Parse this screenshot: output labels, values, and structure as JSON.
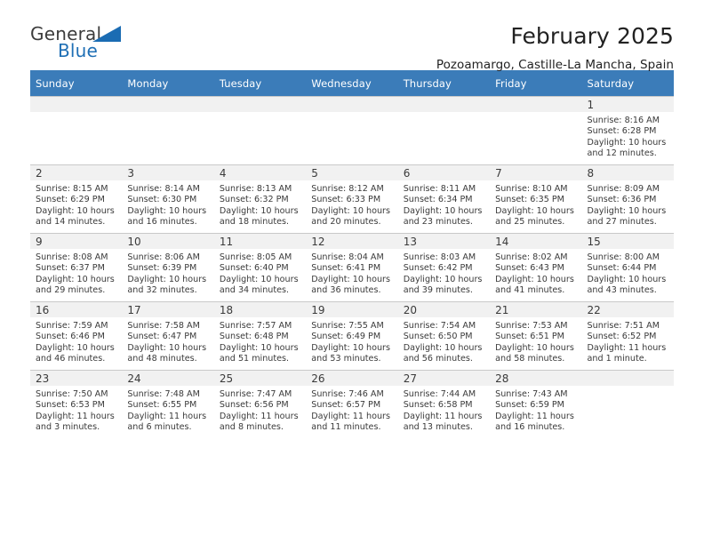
{
  "brand": {
    "word1": "General",
    "word2": "Blue",
    "triangle_color": "#1b6cb3",
    "text_color": "#3c3c3c"
  },
  "header": {
    "title": "February 2025",
    "subtitle": "Pozoamargo, Castille-La Mancha, Spain"
  },
  "theme": {
    "header_blue": "#3b7cb9",
    "daynum_band": "#f1f1f1",
    "grid_line": "#c9c9c9"
  },
  "weekday_headers": [
    "Sunday",
    "Monday",
    "Tuesday",
    "Wednesday",
    "Thursday",
    "Friday",
    "Saturday"
  ],
  "labels": {
    "sunrise_prefix": "Sunrise: ",
    "sunset_prefix": "Sunset: ",
    "daylight_prefix": "Daylight: "
  },
  "weeks": [
    [
      {
        "day": "",
        "sunrise": "",
        "sunset": "",
        "daylight": ""
      },
      {
        "day": "",
        "sunrise": "",
        "sunset": "",
        "daylight": ""
      },
      {
        "day": "",
        "sunrise": "",
        "sunset": "",
        "daylight": ""
      },
      {
        "day": "",
        "sunrise": "",
        "sunset": "",
        "daylight": ""
      },
      {
        "day": "",
        "sunrise": "",
        "sunset": "",
        "daylight": ""
      },
      {
        "day": "",
        "sunrise": "",
        "sunset": "",
        "daylight": ""
      },
      {
        "day": "1",
        "sunrise": "Sunrise: 8:16 AM",
        "sunset": "Sunset: 6:28 PM",
        "daylight": "Daylight: 10 hours and 12 minutes."
      }
    ],
    [
      {
        "day": "2",
        "sunrise": "Sunrise: 8:15 AM",
        "sunset": "Sunset: 6:29 PM",
        "daylight": "Daylight: 10 hours and 14 minutes."
      },
      {
        "day": "3",
        "sunrise": "Sunrise: 8:14 AM",
        "sunset": "Sunset: 6:30 PM",
        "daylight": "Daylight: 10 hours and 16 minutes."
      },
      {
        "day": "4",
        "sunrise": "Sunrise: 8:13 AM",
        "sunset": "Sunset: 6:32 PM",
        "daylight": "Daylight: 10 hours and 18 minutes."
      },
      {
        "day": "5",
        "sunrise": "Sunrise: 8:12 AM",
        "sunset": "Sunset: 6:33 PM",
        "daylight": "Daylight: 10 hours and 20 minutes."
      },
      {
        "day": "6",
        "sunrise": "Sunrise: 8:11 AM",
        "sunset": "Sunset: 6:34 PM",
        "daylight": "Daylight: 10 hours and 23 minutes."
      },
      {
        "day": "7",
        "sunrise": "Sunrise: 8:10 AM",
        "sunset": "Sunset: 6:35 PM",
        "daylight": "Daylight: 10 hours and 25 minutes."
      },
      {
        "day": "8",
        "sunrise": "Sunrise: 8:09 AM",
        "sunset": "Sunset: 6:36 PM",
        "daylight": "Daylight: 10 hours and 27 minutes."
      }
    ],
    [
      {
        "day": "9",
        "sunrise": "Sunrise: 8:08 AM",
        "sunset": "Sunset: 6:37 PM",
        "daylight": "Daylight: 10 hours and 29 minutes."
      },
      {
        "day": "10",
        "sunrise": "Sunrise: 8:06 AM",
        "sunset": "Sunset: 6:39 PM",
        "daylight": "Daylight: 10 hours and 32 minutes."
      },
      {
        "day": "11",
        "sunrise": "Sunrise: 8:05 AM",
        "sunset": "Sunset: 6:40 PM",
        "daylight": "Daylight: 10 hours and 34 minutes."
      },
      {
        "day": "12",
        "sunrise": "Sunrise: 8:04 AM",
        "sunset": "Sunset: 6:41 PM",
        "daylight": "Daylight: 10 hours and 36 minutes."
      },
      {
        "day": "13",
        "sunrise": "Sunrise: 8:03 AM",
        "sunset": "Sunset: 6:42 PM",
        "daylight": "Daylight: 10 hours and 39 minutes."
      },
      {
        "day": "14",
        "sunrise": "Sunrise: 8:02 AM",
        "sunset": "Sunset: 6:43 PM",
        "daylight": "Daylight: 10 hours and 41 minutes."
      },
      {
        "day": "15",
        "sunrise": "Sunrise: 8:00 AM",
        "sunset": "Sunset: 6:44 PM",
        "daylight": "Daylight: 10 hours and 43 minutes."
      }
    ],
    [
      {
        "day": "16",
        "sunrise": "Sunrise: 7:59 AM",
        "sunset": "Sunset: 6:46 PM",
        "daylight": "Daylight: 10 hours and 46 minutes."
      },
      {
        "day": "17",
        "sunrise": "Sunrise: 7:58 AM",
        "sunset": "Sunset: 6:47 PM",
        "daylight": "Daylight: 10 hours and 48 minutes."
      },
      {
        "day": "18",
        "sunrise": "Sunrise: 7:57 AM",
        "sunset": "Sunset: 6:48 PM",
        "daylight": "Daylight: 10 hours and 51 minutes."
      },
      {
        "day": "19",
        "sunrise": "Sunrise: 7:55 AM",
        "sunset": "Sunset: 6:49 PM",
        "daylight": "Daylight: 10 hours and 53 minutes."
      },
      {
        "day": "20",
        "sunrise": "Sunrise: 7:54 AM",
        "sunset": "Sunset: 6:50 PM",
        "daylight": "Daylight: 10 hours and 56 minutes."
      },
      {
        "day": "21",
        "sunrise": "Sunrise: 7:53 AM",
        "sunset": "Sunset: 6:51 PM",
        "daylight": "Daylight: 10 hours and 58 minutes."
      },
      {
        "day": "22",
        "sunrise": "Sunrise: 7:51 AM",
        "sunset": "Sunset: 6:52 PM",
        "daylight": "Daylight: 11 hours and 1 minute."
      }
    ],
    [
      {
        "day": "23",
        "sunrise": "Sunrise: 7:50 AM",
        "sunset": "Sunset: 6:53 PM",
        "daylight": "Daylight: 11 hours and 3 minutes."
      },
      {
        "day": "24",
        "sunrise": "Sunrise: 7:48 AM",
        "sunset": "Sunset: 6:55 PM",
        "daylight": "Daylight: 11 hours and 6 minutes."
      },
      {
        "day": "25",
        "sunrise": "Sunrise: 7:47 AM",
        "sunset": "Sunset: 6:56 PM",
        "daylight": "Daylight: 11 hours and 8 minutes."
      },
      {
        "day": "26",
        "sunrise": "Sunrise: 7:46 AM",
        "sunset": "Sunset: 6:57 PM",
        "daylight": "Daylight: 11 hours and 11 minutes."
      },
      {
        "day": "27",
        "sunrise": "Sunrise: 7:44 AM",
        "sunset": "Sunset: 6:58 PM",
        "daylight": "Daylight: 11 hours and 13 minutes."
      },
      {
        "day": "28",
        "sunrise": "Sunrise: 7:43 AM",
        "sunset": "Sunset: 6:59 PM",
        "daylight": "Daylight: 11 hours and 16 minutes."
      },
      {
        "day": "",
        "sunrise": "",
        "sunset": "",
        "daylight": ""
      }
    ]
  ]
}
